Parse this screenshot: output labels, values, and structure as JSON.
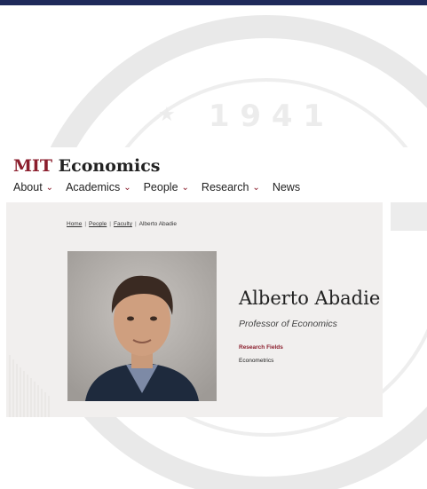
{
  "header": {
    "logo_mit": "MIT",
    "logo_rest": " Economics"
  },
  "nav": [
    {
      "label": "About",
      "dropdown": true
    },
    {
      "label": "Academics",
      "dropdown": true
    },
    {
      "label": "People",
      "dropdown": true
    },
    {
      "label": "Research",
      "dropdown": true
    },
    {
      "label": "News",
      "dropdown": false
    }
  ],
  "breadcrumb": {
    "home": "Home",
    "people": "People",
    "faculty": "Faculty",
    "current": "Alberto Abadie",
    "separator": "|"
  },
  "profile": {
    "name": "Alberto Abadie",
    "title": "Professor of Economics",
    "research_fields_label": "Research Fields",
    "research_fields_value": "Econometrics"
  },
  "watermark": {
    "year": "1 9 4 1"
  },
  "colors": {
    "brand": "#8b1e2d",
    "topbar": "#1f2a5a",
    "hero_bg": "#f1efee"
  }
}
